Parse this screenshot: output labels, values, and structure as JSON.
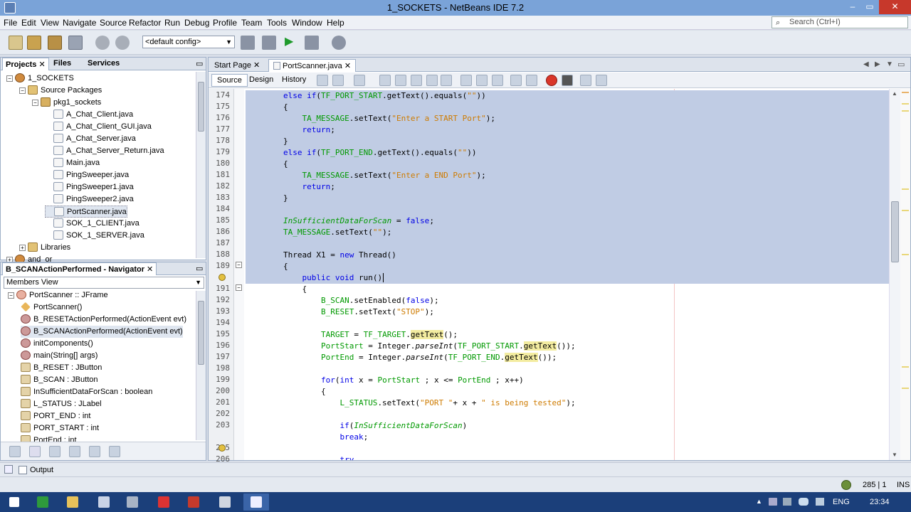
{
  "window": {
    "title": "1_SOCKETS - NetBeans IDE 7.2",
    "minimize": "–",
    "maximize": "▭",
    "close": "✕"
  },
  "menu": [
    "File",
    "Edit",
    "View",
    "Navigate",
    "Source",
    "Refactor",
    "Run",
    "Debug",
    "Profile",
    "Team",
    "Tools",
    "Window",
    "Help"
  ],
  "search": {
    "placeholder": "Search (Ctrl+I)"
  },
  "toolbar": {
    "config": "<default config>"
  },
  "projects_panel": {
    "tabs": [
      "Projects",
      "Files",
      "Services"
    ],
    "tree": [
      {
        "label": "1_SOCKETS",
        "icon": "proj",
        "level": 0,
        "exp": "−"
      },
      {
        "label": "Source Packages",
        "icon": "folder",
        "level": 1,
        "exp": "−"
      },
      {
        "label": "pkg1_sockets",
        "icon": "pkg",
        "level": 2,
        "exp": "−"
      },
      {
        "label": "A_Chat_Client.java",
        "icon": "java",
        "level": 3
      },
      {
        "label": "A_Chat_Client_GUI.java",
        "icon": "java",
        "level": 3
      },
      {
        "label": "A_Chat_Server.java",
        "icon": "java",
        "level": 3
      },
      {
        "label": "A_Chat_Server_Return.java",
        "icon": "java",
        "level": 3
      },
      {
        "label": "Main.java",
        "icon": "java",
        "level": 3
      },
      {
        "label": "PingSweeper.java",
        "icon": "java",
        "level": 3
      },
      {
        "label": "PingSweeper1.java",
        "icon": "java",
        "level": 3
      },
      {
        "label": "PingSweeper2.java",
        "icon": "java",
        "level": 3
      },
      {
        "label": "PortScanner.java",
        "icon": "java",
        "level": 3,
        "selected": true
      },
      {
        "label": "SOK_1_CLIENT.java",
        "icon": "java",
        "level": 3
      },
      {
        "label": "SOK_1_SERVER.java",
        "icon": "java",
        "level": 3
      },
      {
        "label": "Libraries",
        "icon": "folder",
        "level": 1,
        "exp": "+"
      },
      {
        "label": "and_or",
        "icon": "proj",
        "level": 0,
        "exp": "+"
      }
    ]
  },
  "navigator_panel": {
    "title": "B_SCANActionPerformed - Navigator",
    "view": "Members View",
    "members": [
      {
        "label": "PortScanner :: JFrame",
        "icon": "class",
        "level": 0
      },
      {
        "label": "PortScanner()",
        "icon": "ctor",
        "level": 1
      },
      {
        "label": "B_RESETActionPerformed(ActionEvent evt)",
        "icon": "method",
        "level": 1
      },
      {
        "label": "B_SCANActionPerformed(ActionEvent evt)",
        "icon": "method",
        "level": 1,
        "selected": true
      },
      {
        "label": "initComponents()",
        "icon": "method",
        "level": 1
      },
      {
        "label": "main(String[] args)",
        "icon": "method",
        "level": 1
      },
      {
        "label": "B_RESET : JButton",
        "icon": "field",
        "level": 1
      },
      {
        "label": "B_SCAN : JButton",
        "icon": "field",
        "level": 1
      },
      {
        "label": "InSufficientDataForScan : boolean",
        "icon": "field",
        "level": 1
      },
      {
        "label": "L_STATUS : JLabel",
        "icon": "field",
        "level": 1
      },
      {
        "label": "PORT_END : int",
        "icon": "field",
        "level": 1
      },
      {
        "label": "PORT_START : int",
        "icon": "field",
        "level": 1
      },
      {
        "label": "PortEnd : int",
        "icon": "field",
        "level": 1
      }
    ]
  },
  "editor": {
    "tabs": [
      "Start Page",
      "PortScanner.java"
    ],
    "views": [
      "Source",
      "Design",
      "History"
    ],
    "lines": [
      {
        "n": "174",
        "sel": true,
        "h": "<span class='kw'>else if</span>(<span class='fld'>TF_PORT_START</span>.getText().equals(<span class='str'>\"\"</span>))",
        "indent": 2
      },
      {
        "n": "175",
        "sel": true,
        "h": "{",
        "indent": 2
      },
      {
        "n": "176",
        "sel": true,
        "h": "<span class='fld'>TA_MESSAGE</span>.setText(<span class='str'>\"Enter a START Port\"</span>);",
        "indent": 3
      },
      {
        "n": "177",
        "sel": true,
        "h": "<span class='kw'>return</span>;",
        "indent": 3
      },
      {
        "n": "178",
        "sel": true,
        "h": "}",
        "indent": 2
      },
      {
        "n": "179",
        "sel": true,
        "h": "<span class='kw'>else if</span>(<span class='fld'>TF_PORT_END</span>.getText().equals(<span class='str'>\"\"</span>))",
        "indent": 2
      },
      {
        "n": "180",
        "sel": true,
        "h": "{",
        "indent": 2
      },
      {
        "n": "181",
        "sel": true,
        "h": "<span class='fld'>TA_MESSAGE</span>.setText(<span class='str'>\"Enter a END Port\"</span>);",
        "indent": 3
      },
      {
        "n": "182",
        "sel": true,
        "h": "<span class='kw'>return</span>;",
        "indent": 3
      },
      {
        "n": "183",
        "sel": true,
        "h": "}",
        "indent": 2
      },
      {
        "n": "184",
        "sel": true,
        "h": "",
        "indent": 2
      },
      {
        "n": "185",
        "sel": true,
        "h": "<span class='fld it'>InSufficientDataForScan</span> = <span class='kw'>false</span>;",
        "indent": 2
      },
      {
        "n": "186",
        "sel": true,
        "h": "<span class='fld'>TA_MESSAGE</span>.setText(<span class='str'>\"\"</span>);",
        "indent": 2
      },
      {
        "n": "187",
        "sel": true,
        "h": "",
        "indent": 2
      },
      {
        "n": "188",
        "sel": true,
        "h": "Thread X1 = <span class='kw'>new</span> Thread()",
        "indent": 2
      },
      {
        "n": "189",
        "sel": true,
        "h": "{",
        "indent": 2
      },
      {
        "n": "",
        "sel": true,
        "h": "<span class='kw'>public void</span> run()|",
        "indent": 3
      },
      {
        "n": "191",
        "sel": false,
        "h": "{",
        "indent": 3
      },
      {
        "n": "192",
        "sel": false,
        "h": "<span class='fld'>B_SCAN</span>.setEnabled(<span class='kw'>false</span>);",
        "indent": 4
      },
      {
        "n": "193",
        "sel": false,
        "h": "<span class='fld'>B_RESET</span>.setText(<span class='str'>\"STOP\"</span>);",
        "indent": 4
      },
      {
        "n": "194",
        "sel": false,
        "h": "",
        "indent": 4
      },
      {
        "n": "195",
        "sel": false,
        "h": "<span class='fld'>TARGET</span> = <span class='fld'>TF_TARGET</span>.<span class='hl'>getText</span>();",
        "indent": 4
      },
      {
        "n": "196",
        "sel": false,
        "h": "<span class='fld'>PortStart</span> = Integer.<span class='it'>parseInt</span>(<span class='fld'>TF_PORT_START</span>.<span class='hl'>getText</span>());",
        "indent": 4
      },
      {
        "n": "197",
        "sel": false,
        "h": "<span class='fld'>PortEnd</span> = Integer.<span class='it'>parseInt</span>(<span class='fld'>TF_PORT_END</span>.<span class='hl'>getText</span>());",
        "indent": 4
      },
      {
        "n": "198",
        "sel": false,
        "h": "",
        "indent": 4
      },
      {
        "n": "199",
        "sel": false,
        "h": "<span class='kw'>for</span>(<span class='kw'>int</span> x = <span class='fld'>PortStart</span> ; x <= <span class='fld'>PortEnd</span> ; x++)",
        "indent": 4
      },
      {
        "n": "200",
        "sel": false,
        "h": "{",
        "indent": 4
      },
      {
        "n": "201",
        "sel": false,
        "h": "<span class='fld'>L_STATUS</span>.setText(<span class='str'>\"PORT \"</span>+ x + <span class='str'>\" is being tested\"</span>);",
        "indent": 5
      },
      {
        "n": "202",
        "sel": false,
        "h": "",
        "indent": 5
      },
      {
        "n": "203",
        "sel": false,
        "h": "<span class='kw'>if</span>(<span class='fld it'>InSufficientDataForScan</span>)",
        "indent": 5
      },
      {
        "n": "",
        "sel": false,
        "h": "<span class='kw'>break</span>;",
        "indent": 5
      },
      {
        "n": "205",
        "sel": false,
        "h": "",
        "indent": 5
      },
      {
        "n": "206",
        "sel": false,
        "h": "<span class='kw'>try</span>",
        "indent": 5
      }
    ]
  },
  "bottom": {
    "output_label": "Output",
    "position": "285 | 1",
    "mode": "INS"
  },
  "taskbar": {
    "lang": "ENG",
    "time": "23:34"
  }
}
